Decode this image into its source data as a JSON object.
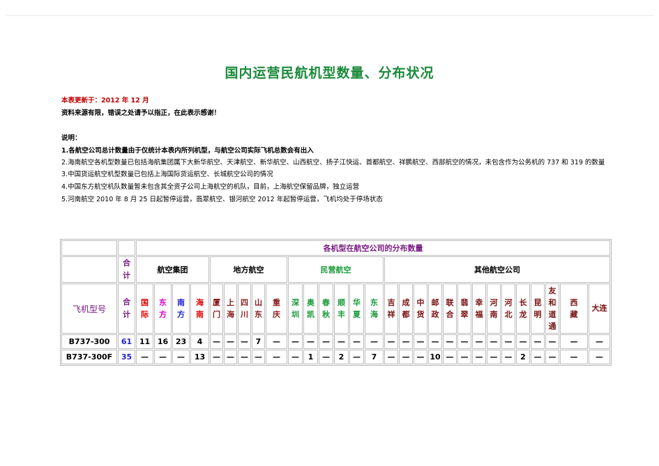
{
  "title": "国内运营民航机型数量、分布状况",
  "updated": "本表更新于：2012 年 12 月",
  "disclaimer": "资料来源有限，错误之处请予以指正，在此表示感谢！",
  "notes_title": "说明：",
  "notes": [
    "1.各航空公司总计数量由于仅统计本表内所列机型，与航空公司实际飞机总数会有出入",
    "2.海南航空各机型数量已包括海航集团属下大新华航空、天津航空、新华航空、山西航空、扬子江快运、首都航空、祥鹏航空、西部航空的情况，未包含作为公务机的 737 和 319 的数量",
    "3.中国货运航空机型数量已包括上海国际货运航空、长城航空公司的情况",
    "4.中国东方航空机队数量暂未包含其全资子公司上海航空的机队，目前，上海航空保留品牌，独立运营",
    "5.河南航空 2010 年 8 月 25 日起暂停运营，翡翠航空、银河航空 2012 年起暂停运营，飞机均处于停场状态"
  ],
  "table": {
    "main_header": "各机型在航空公司的分布数量",
    "total_label": "合计",
    "model_label": "飞机型号",
    "groups": {
      "g1": "航空集团",
      "g2": "地方航空",
      "g3": "民营航空",
      "g4": "其他航空公司"
    },
    "airlines": [
      "国际",
      "东方",
      "南方",
      "海南",
      "厦门",
      "上海",
      "四川",
      "山东",
      "重庆",
      "深圳",
      "奥凯",
      "春秋",
      "顺丰",
      "华夏",
      "东海",
      "吉祥",
      "成都",
      "中货",
      "邮政",
      "联合",
      "翡翠",
      "幸福",
      "河南",
      "河北",
      "长龙",
      "昆明",
      "友和道通",
      "西藏",
      "大连"
    ],
    "rows": [
      {
        "model": "B737-300",
        "total": "61",
        "cells": [
          "11",
          "16",
          "23",
          "4",
          "—",
          "—",
          "—",
          "7",
          "—",
          "—",
          "—",
          "—",
          "—",
          "—",
          "—",
          "—",
          "—",
          "—",
          "—",
          "—",
          "—",
          "—",
          "—",
          "—",
          "—",
          "—",
          "—",
          "—",
          "—"
        ]
      },
      {
        "model": "B737-300F",
        "total": "35",
        "cells": [
          "—",
          "—",
          "—",
          "13",
          "—",
          "—",
          "—",
          "—",
          "—",
          "—",
          "1",
          "—",
          "2",
          "—",
          "7",
          "—",
          "—",
          "—",
          "10",
          "—",
          "—",
          "—",
          "—",
          "—",
          "2",
          "—",
          "—",
          "—",
          "—"
        ]
      }
    ]
  }
}
